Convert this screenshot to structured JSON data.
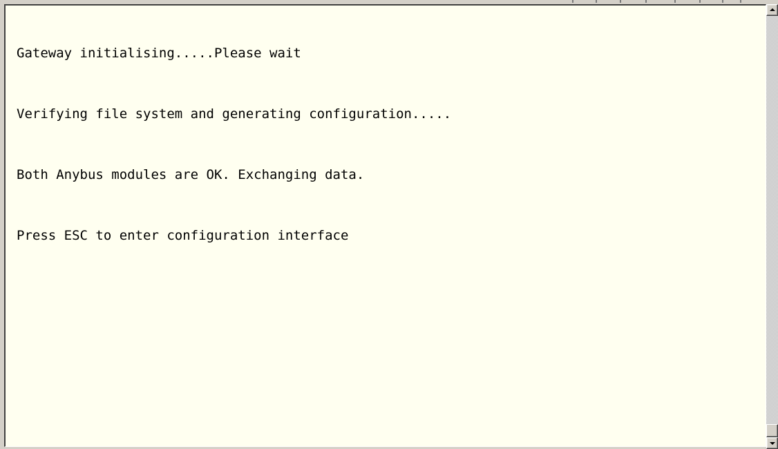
{
  "terminal": {
    "lines": [
      "Gateway initialising.....Please wait",
      "Verifying file system and generating configuration.....",
      "Both Anybus modules are OK. Exchanging data.",
      "Press ESC to enter configuration interface"
    ],
    "text_color": "#000000",
    "background_color": "#fffff0"
  },
  "scrollbar": {
    "up_icon": "triangle-up-icon",
    "down_icon": "triangle-down-icon",
    "position": 1.0
  }
}
